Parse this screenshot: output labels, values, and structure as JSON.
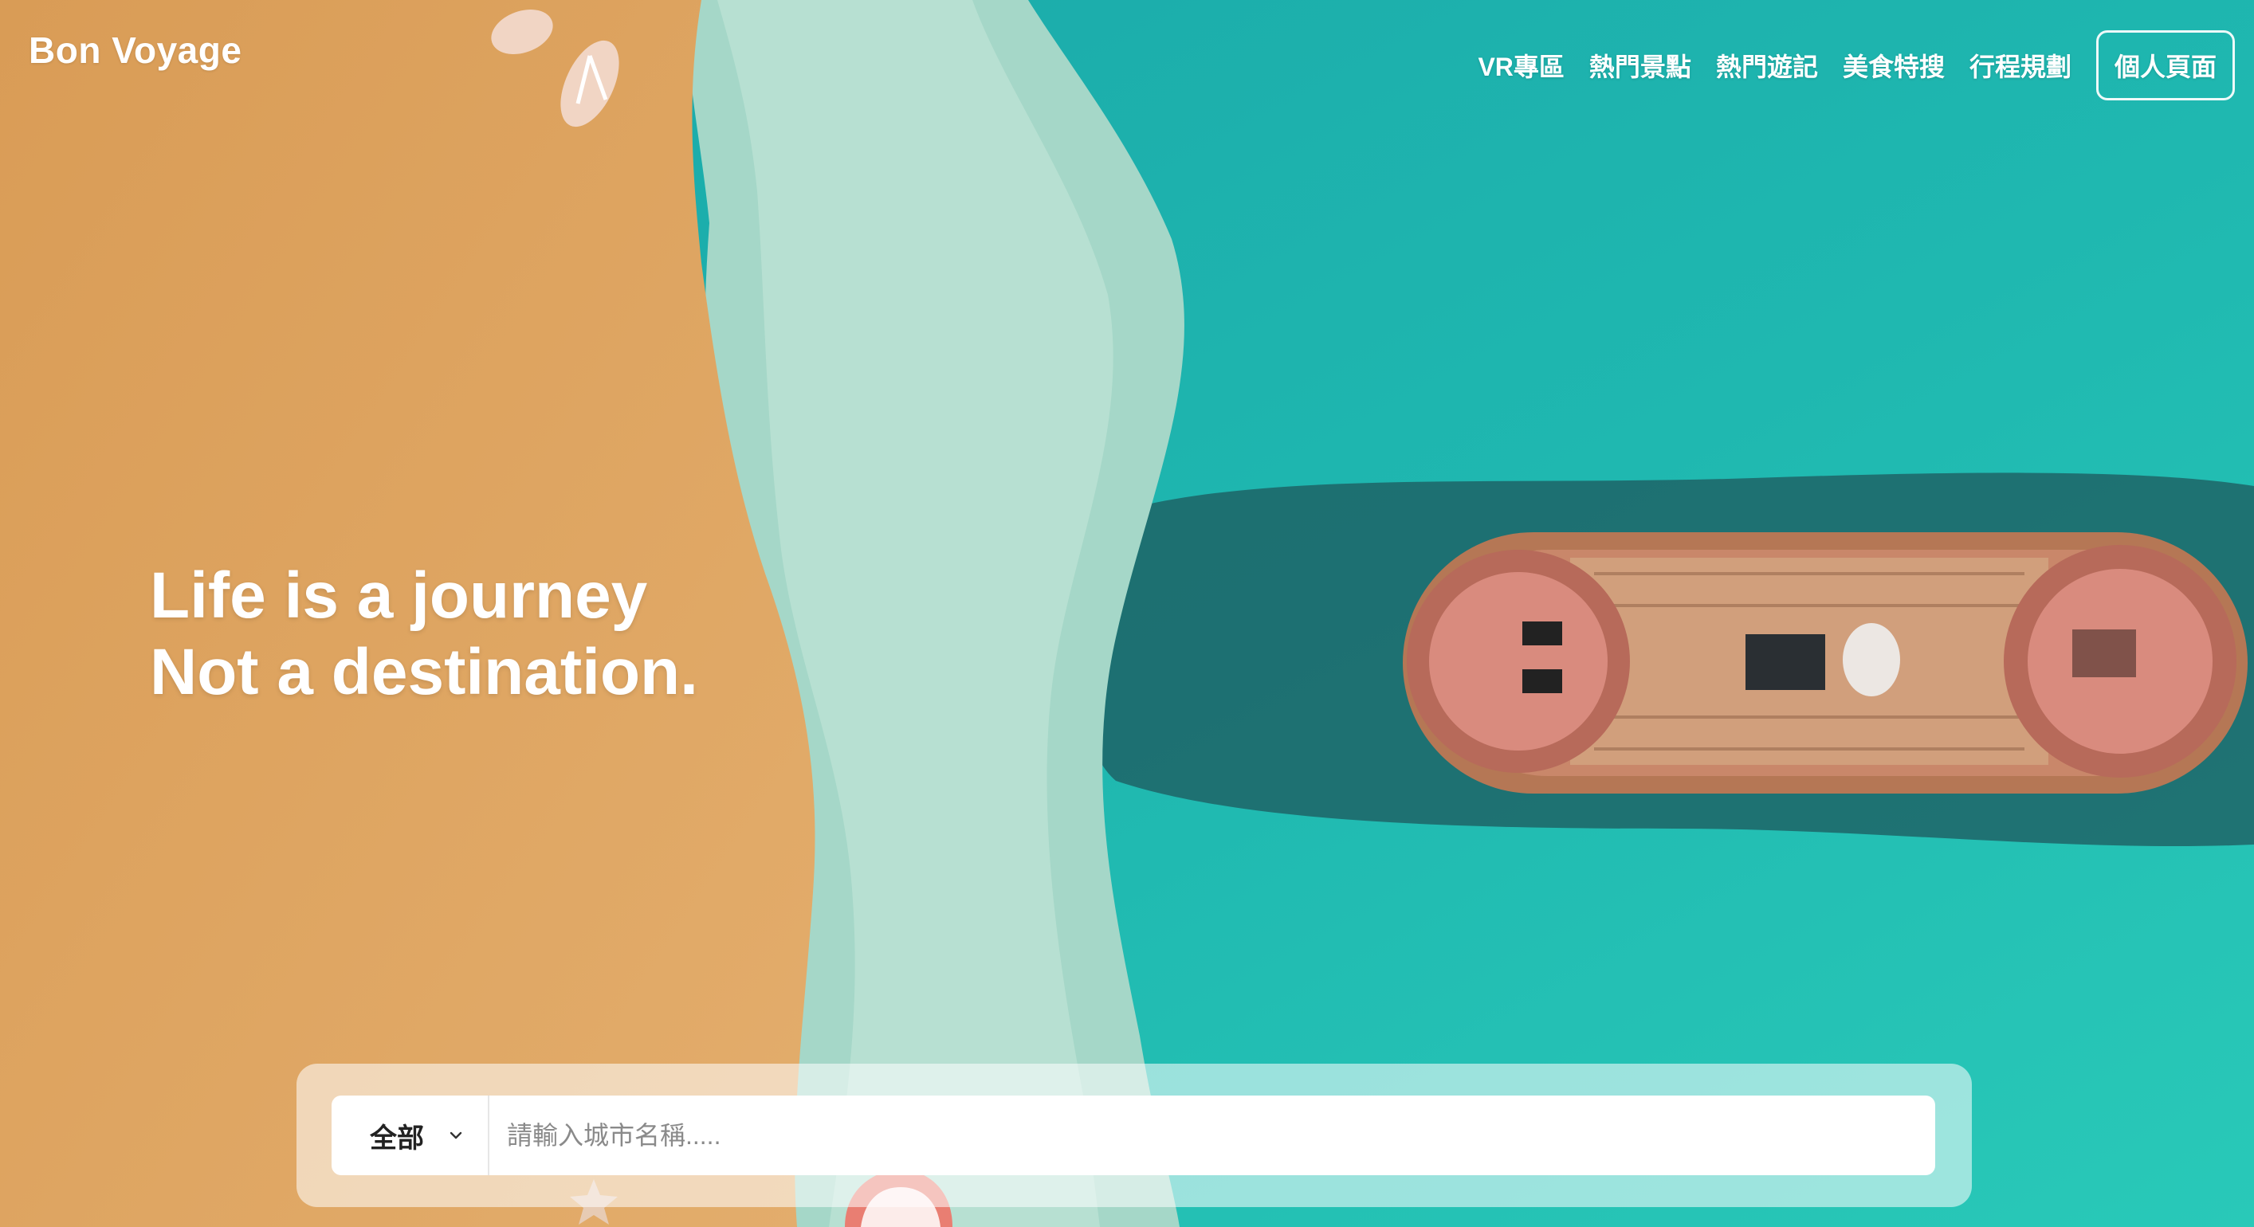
{
  "header": {
    "logo": "Bon Voyage",
    "nav": [
      {
        "label": "VR專區"
      },
      {
        "label": "熱門景點"
      },
      {
        "label": "熱門遊記"
      },
      {
        "label": "美食特搜"
      },
      {
        "label": "行程規劃"
      }
    ],
    "profile_label": "個人頁面"
  },
  "hero": {
    "line1": "Life is a journey",
    "line2": "Not a destination."
  },
  "search": {
    "category": "全部",
    "placeholder": "請輸入城市名稱....."
  },
  "colors": {
    "sand": "#d9a05b",
    "wave_foam": "#a8d8cb",
    "sea": "#1fb7b2",
    "ship_deck": "#c98a6b",
    "text": "#ffffff"
  }
}
